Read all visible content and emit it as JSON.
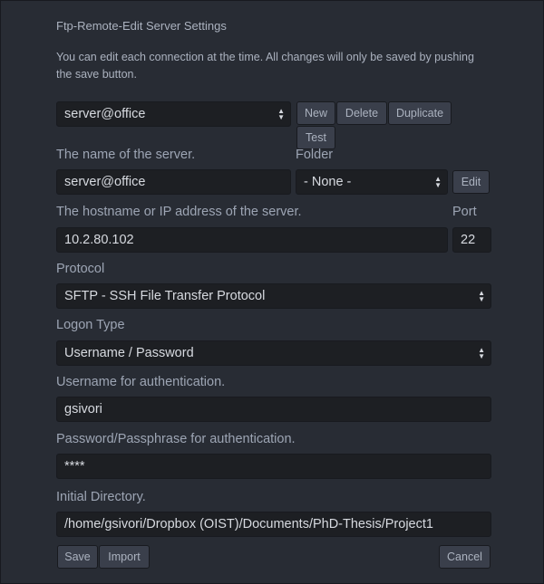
{
  "dialog": {
    "title": "Ftp-Remote-Edit Server Settings",
    "description": "You can edit each connection at the time. All changes will only be saved by pushing the save button."
  },
  "server_select": {
    "value": "server@office"
  },
  "server_buttons": {
    "new": "New",
    "delete": "Delete",
    "duplicate": "Duplicate",
    "test": "Test"
  },
  "name": {
    "label": "The name of the server.",
    "value": "server@office"
  },
  "folder": {
    "label": "Folder",
    "value": "- None -",
    "edit": "Edit"
  },
  "host": {
    "label": "The hostname or IP address of the server.",
    "value": "10.2.80.102"
  },
  "port": {
    "label": "Port",
    "value": "22"
  },
  "protocol": {
    "label": "Protocol",
    "value": "SFTP - SSH File Transfer Protocol"
  },
  "logon": {
    "label": "Logon Type",
    "value": "Username / Password"
  },
  "username": {
    "label": "Username for authentication.",
    "value": "gsivori"
  },
  "password": {
    "label": "Password/Passphrase for authentication.",
    "value": "****"
  },
  "directory": {
    "label": "Initial Directory.",
    "value": "/home/gsivori/Dropbox (OIST)/Documents/PhD-Thesis/Project1"
  },
  "footer": {
    "save": "Save",
    "import": "Import",
    "cancel": "Cancel"
  },
  "colors": {
    "background": "#282c34",
    "input_bg": "#1d1f23",
    "button_bg": "#3a3f4b",
    "text": "#9da5b4",
    "value_text": "#d7dae0"
  }
}
